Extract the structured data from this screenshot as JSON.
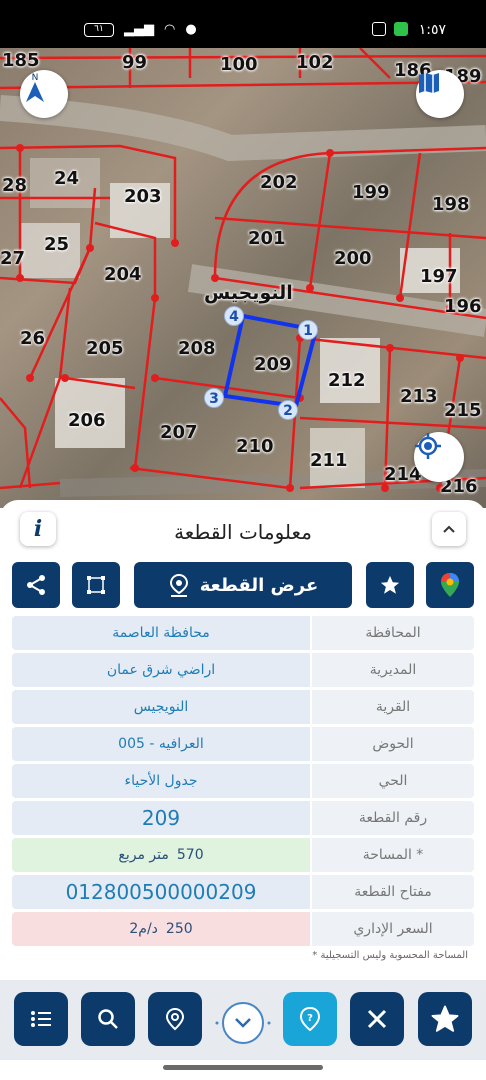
{
  "status_bar": {
    "time": "١:٥٧",
    "battery": "٦١"
  },
  "map": {
    "village_label": "النويجيس",
    "parcels": [
      {
        "num": "185"
      },
      {
        "num": "99"
      },
      {
        "num": "100"
      },
      {
        "num": "102"
      },
      {
        "num": "186"
      },
      {
        "num": "189"
      },
      {
        "num": "28"
      },
      {
        "num": "24"
      },
      {
        "num": "203"
      },
      {
        "num": "202"
      },
      {
        "num": "199"
      },
      {
        "num": "198"
      },
      {
        "num": "25"
      },
      {
        "num": "27"
      },
      {
        "num": "201"
      },
      {
        "num": "200"
      },
      {
        "num": "197"
      },
      {
        "num": "204"
      },
      {
        "num": "196"
      },
      {
        "num": "26"
      },
      {
        "num": "205"
      },
      {
        "num": "208"
      },
      {
        "num": "209"
      },
      {
        "num": "212"
      },
      {
        "num": "213"
      },
      {
        "num": "215"
      },
      {
        "num": "206"
      },
      {
        "num": "207"
      },
      {
        "num": "210"
      },
      {
        "num": "211"
      },
      {
        "num": "214"
      },
      {
        "num": "216"
      }
    ],
    "vertices": [
      "1",
      "2",
      "3",
      "4"
    ],
    "north_label": "N"
  },
  "panel": {
    "title": "معلومات القطعة",
    "info_label": "i",
    "show_parcel_label": "عرض القطعة"
  },
  "fields": {
    "governorate": {
      "label": "المحافظة",
      "value": "محافظة العاصمة"
    },
    "directorate": {
      "label": "المديرية",
      "value": "اراضي شرق عمان"
    },
    "village": {
      "label": "القرية",
      "value": "النويجيس"
    },
    "basin": {
      "label": "الحوض",
      "value": "العرافيه - 005"
    },
    "neighborhood": {
      "label": "الحي",
      "value": "جدول الأحياء"
    },
    "parcel_number": {
      "label": "رقم القطعة",
      "value": "209"
    },
    "area": {
      "label": "المساحة *",
      "unit": "متر مربع",
      "value": "570"
    },
    "parcel_key": {
      "label": "مفتاح القطعة",
      "value": "012800500000209"
    },
    "admin_price": {
      "label": "السعر الإداري",
      "unit": "د/م2",
      "value": "250"
    }
  },
  "note": "* المساحة المحسوبة وليس التسجيلية",
  "colors": {
    "primary": "#0c3a6b",
    "accent": "#1aa5d9",
    "parcel_line": "#e21d1d",
    "selection": "#1133ee"
  }
}
